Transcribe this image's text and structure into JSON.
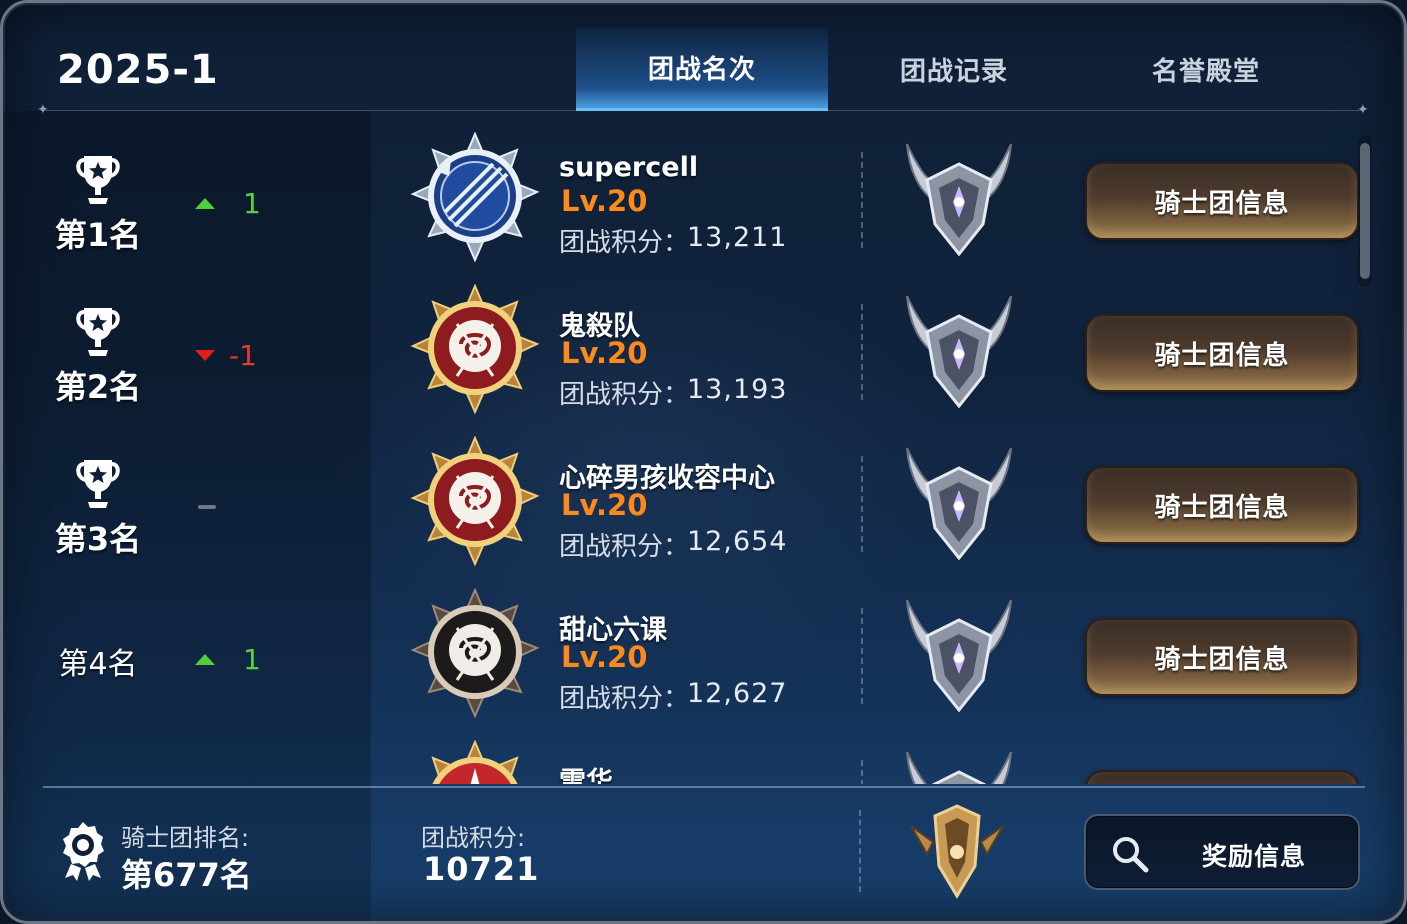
{
  "season": "2025-1",
  "tabs": [
    {
      "label": "团战名次",
      "active": true
    },
    {
      "label": "团战记录",
      "active": false
    },
    {
      "label": "名誉殿堂",
      "active": false
    }
  ],
  "rows": [
    {
      "rank": "第1名",
      "trophy": true,
      "change_dir": "up",
      "change": "1",
      "emblem": "blue-compass-emblem",
      "name": "supercell",
      "level": "Lv.20",
      "score_label": "团战积分：",
      "score": "13,211",
      "button": "骑士团信息"
    },
    {
      "rank": "第2名",
      "trophy": true,
      "change_dir": "down",
      "change": "-1",
      "emblem": "red-rose-emblem",
      "name": "鬼殺队",
      "level": "Lv.20",
      "score_label": "团战积分：",
      "score": "13,193",
      "button": "骑士团信息"
    },
    {
      "rank": "第3名",
      "trophy": true,
      "change_dir": "none",
      "change": "",
      "emblem": "red-rose-emblem",
      "name": "心碎男孩收容中心",
      "level": "Lv.20",
      "score_label": "团战积分：",
      "score": "12,654",
      "button": "骑士团信息"
    },
    {
      "rank": "第4名",
      "trophy": false,
      "change_dir": "up",
      "change": "1",
      "emblem": "black-rose-emblem",
      "name": "甜心六课",
      "level": "Lv.20",
      "score_label": "团战积分：",
      "score": "12,627",
      "button": "骑士团信息"
    },
    {
      "rank": "",
      "trophy": false,
      "change_dir": "none",
      "change": "",
      "emblem": "red-white-emblem",
      "name": "雪华",
      "level": "",
      "score_label": "",
      "score": "",
      "button": ""
    }
  ],
  "footer": {
    "rank_label": "骑士团排名:",
    "rank_value": "第677名",
    "score_label": "团战积分:",
    "score_value": "10721",
    "reward_button": "奖励信息"
  },
  "colors": {
    "level": "#ff8a1c",
    "up": "#56d13f",
    "down": "#e23a2e",
    "active_tab": "#5fc2ff",
    "button_gold": "#a58457"
  }
}
